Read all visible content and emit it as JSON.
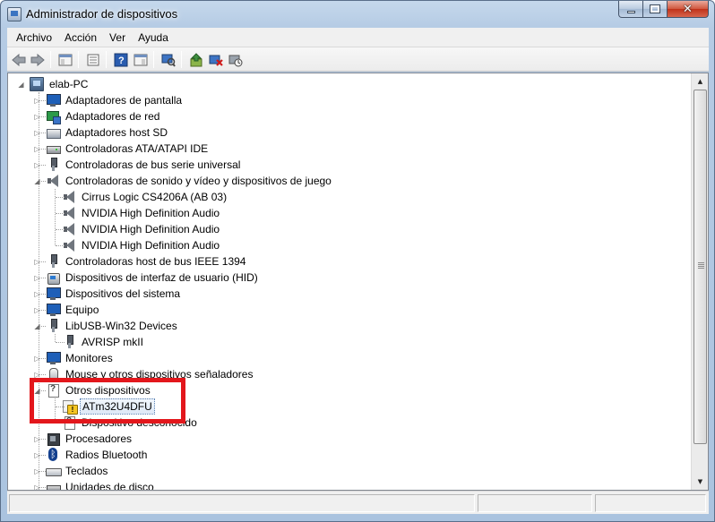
{
  "window": {
    "title": "Administrador de dispositivos"
  },
  "menu": [
    "Archivo",
    "Acción",
    "Ver",
    "Ayuda"
  ],
  "toolbar": {
    "buttons": [
      "back-icon",
      "forward-icon",
      "console-tree-icon",
      "properties-icon",
      "help-icon",
      "show-hide-icon",
      "scan-hardware-icon",
      "update-driver-icon",
      "uninstall-icon",
      "disable-icon"
    ]
  },
  "tree": {
    "root": "elab-PC",
    "items": [
      {
        "label": "Adaptadores de pantalla",
        "icon": "monitor-icon"
      },
      {
        "label": "Adaptadores de red",
        "icon": "network-adapter-icon"
      },
      {
        "label": "Adaptadores host SD",
        "icon": "sd-host-icon"
      },
      {
        "label": "Controladoras ATA/ATAPI IDE",
        "icon": "ide-controller-icon"
      },
      {
        "label": "Controladoras de bus serie universal",
        "icon": "usb-icon"
      },
      {
        "label": "Controladoras de sonido y vídeo y dispositivos de juego",
        "icon": "speaker-icon",
        "children": [
          "Cirrus Logic CS4206A (AB 03)",
          "NVIDIA High Definition Audio",
          "NVIDIA High Definition Audio",
          "NVIDIA High Definition Audio"
        ]
      },
      {
        "label": "Controladoras host de bus IEEE 1394",
        "icon": "ieee1394-icon"
      },
      {
        "label": "Dispositivos de interfaz de usuario (HID)",
        "icon": "hid-icon"
      },
      {
        "label": "Dispositivos del sistema",
        "icon": "system-device-icon"
      },
      {
        "label": "Equipo",
        "icon": "computer-icon"
      },
      {
        "label": "LibUSB-Win32 Devices",
        "icon": "usb-icon",
        "children": [
          "AVRISP mkII"
        ]
      },
      {
        "label": "Monitores",
        "icon": "monitor-icon"
      },
      {
        "label": "Mouse y otros dispositivos señaladores",
        "icon": "mouse-icon"
      },
      {
        "label": "Otros dispositivos",
        "icon": "unknown-device-icon",
        "children": [
          "ATm32U4DFU",
          "Dispositivo desconocido"
        ]
      },
      {
        "label": "Procesadores",
        "icon": "processor-icon"
      },
      {
        "label": "Radios Bluetooth",
        "icon": "bluetooth-icon"
      },
      {
        "label": "Teclados",
        "icon": "keyboard-icon"
      },
      {
        "label": "Unidades de disco",
        "icon": "disk-drive-icon"
      }
    ],
    "selected": "ATm32U4DFU"
  },
  "colors": {
    "annotation": "#e3171c",
    "selection": "#dde8f6"
  }
}
